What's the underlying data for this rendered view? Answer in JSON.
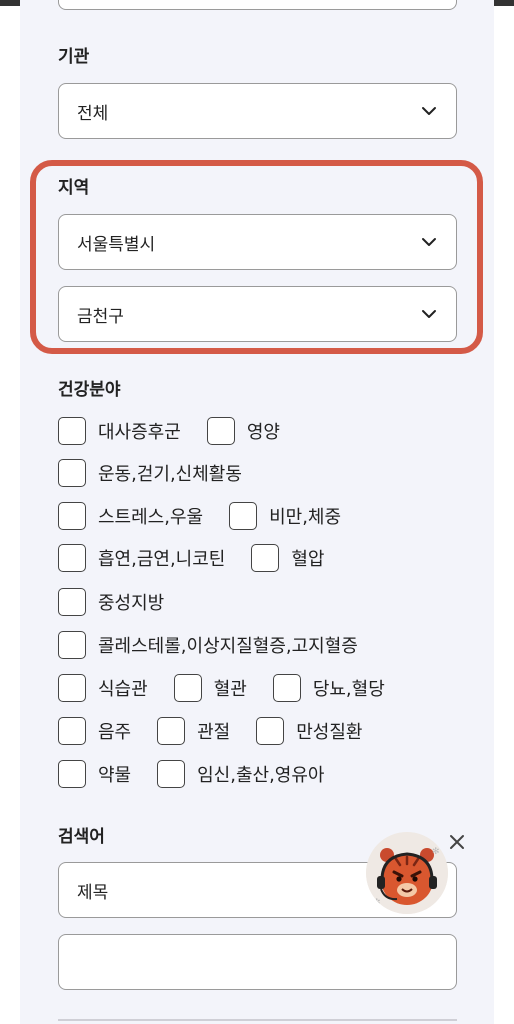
{
  "filters": {
    "agency": {
      "label": "기관",
      "value": "전체"
    },
    "region": {
      "label": "지역",
      "city": "서울특별시",
      "district": "금천구"
    },
    "health": {
      "label": "건강분야",
      "rows": [
        [
          "대사증후군",
          "영양"
        ],
        [
          "운동,걷기,신체활동"
        ],
        [
          "스트레스,우울",
          "비만,체중"
        ],
        [
          "흡연,금연,니코틴",
          "혈압"
        ],
        [
          "중성지방"
        ],
        [
          "콜레스테롤,이상지질혈증,고지혈증"
        ],
        [
          "식습관",
          "혈관",
          "당뇨,혈당"
        ],
        [
          "음주",
          "관절",
          "만성질환"
        ],
        [
          "약물",
          "임신,출산,영유아"
        ]
      ]
    },
    "search": {
      "label": "검색어",
      "type_value": "제목",
      "query": ""
    }
  },
  "icons": {
    "dropdown": "chevron-down-icon",
    "close": "close-icon",
    "chatbot": "mascot-chatbot-icon"
  },
  "colors": {
    "highlight": "#d45a47",
    "panel": "#f3f4fa"
  }
}
